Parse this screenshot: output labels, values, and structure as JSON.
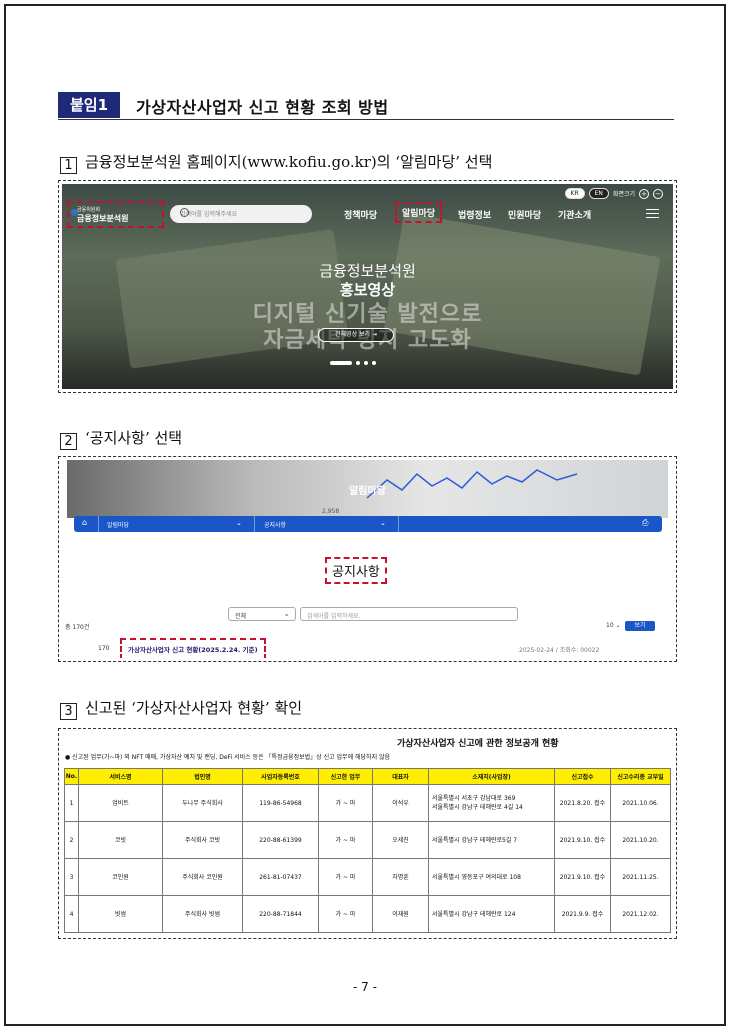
{
  "heading": {
    "tag": "붙임1",
    "title": "가상자산사업자 신고 현황 조회 방법"
  },
  "steps": [
    {
      "num": "1",
      "text": "금융정보분석원 홈페이지(www.kofiu.go.kr)의 ‘알림마당’ 선택"
    },
    {
      "num": "2",
      "text": "‘공지사항’ 선택"
    },
    {
      "num": "3",
      "text": "신고된 ‘가상자산사업자 현황’ 확인"
    }
  ],
  "shot1": {
    "lang_kr": "KR",
    "lang_en": "EN",
    "zoom_label": "화면크기",
    "zoom_in": "+",
    "zoom_out": "−",
    "logo_top": "금융위원회",
    "logo_name": "금융정보분석원",
    "search_placeholder": "검색어를 입력해주세요",
    "nav": [
      "정책마당",
      "알림마당",
      "법령정보",
      "민원마당",
      "기관소개"
    ],
    "hero_line1": "금융정보분석원",
    "hero_line2": "홍보영상",
    "hero_line3": "디지털 신기술 발전으로",
    "hero_line4": "자금세탁 방지 고도화",
    "hero_button": "전체영상 보기 →"
  },
  "shot2": {
    "hero_title": "알림마당",
    "hero_note": "2,958",
    "nav_home": "⌂",
    "nav_section": "알림마당",
    "nav_page": "공지사항",
    "page_title": "공지사항",
    "select_value": "전체",
    "search_placeholder": "검색어를 입력하세요.",
    "count": "총 170건",
    "per_page": "10",
    "view_button": "보기",
    "row_num": "170",
    "row_title": "가상자산사업자 신고 현황(2025.2.24. 기준)",
    "row_meta": "2025-02-24 / 조회수: 00022"
  },
  "shot3": {
    "title": "가상자산사업자 신고에 관한 정보공개 현황",
    "note": "● 신고된 업무(가~마) 외 NFT 매매, 가상자산 예치 및 랜딩, DeFi 서비스 등은 「특정금융정보법」상 신고 업무에 해당하지 않음",
    "columns": [
      "No.",
      "서비스명",
      "법인명",
      "사업자등록번호",
      "신고한 업무",
      "대표자",
      "소재지(사업장)",
      "신고접수",
      "신고수리증 교부일"
    ],
    "rows": [
      [
        "1",
        "업비트",
        "두나무 주식회사",
        "119-86-54968",
        "가 ~ 마",
        "이석우",
        "서울특별시 서초구 강남대로 369\n서울특별시 강남구 테헤란로 4길 14",
        "2021.8.20. 접수",
        "2021.10.06."
      ],
      [
        "2",
        "코빗",
        "주식회사 코빗",
        "220-88-61399",
        "가 ~ 마",
        "오세진",
        "서울특별시 강남구 테헤란로5길 7",
        "2021.9.10. 접수",
        "2021.10.20."
      ],
      [
        "3",
        "코인원",
        "주식회사 코인원",
        "261-81-07437",
        "가 ~ 마",
        "차명훈",
        "서울특별시 영등포구 여의대로 108",
        "2021.9.10. 접수",
        "2021.11.25."
      ],
      [
        "4",
        "빗썸",
        "주식회사 빗썸",
        "220-88-71844",
        "가 ~ 마",
        "이재원",
        "서울특별시 강남구 테헤란로 124",
        "2021.9.9. 접수",
        "2021.12.02."
      ]
    ]
  },
  "page_number": "- 7 -"
}
